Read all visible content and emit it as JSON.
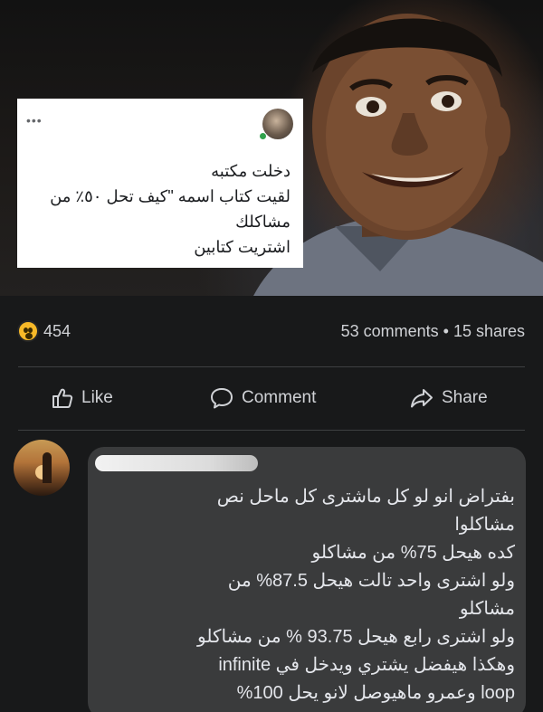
{
  "quoted_post": {
    "more_icon": "more-horizontal-icon",
    "lines": [
      "دخلت مكتبه",
      "لقيت كتاب اسمه \"كيف تحل ٥٠٪ من",
      "مشاكلك",
      "اشتريت كتابين"
    ]
  },
  "stats": {
    "reaction_icon": "haha-emoji-icon",
    "reaction_count": "454",
    "comments": "53 comments",
    "separator": "•",
    "shares": "15 shares"
  },
  "actions": {
    "like_label": "Like",
    "comment_label": "Comment",
    "share_label": "Share"
  },
  "comment": {
    "lines": [
      "بفتراض انو لو كل ماشترى كل ماحل نص",
      "مشاكلوا",
      "كده هيحل 75% من مشاكلو",
      "ولو اشترى واحد تالت هيحل 87.5% من",
      "مشاكلو",
      "ولو اشترى رابع هيحل 93.75 % من مشاكلو",
      "وهكذا هيفضل يشتري ويدخل في infinite",
      "loop وعمرو ماهيوصل لانو يحل 100%"
    ]
  },
  "colors": {
    "background": "#18191a",
    "comment_bubble": "#3a3b3c",
    "text": "#e4e6eb",
    "reaction": "#f7b928"
  }
}
